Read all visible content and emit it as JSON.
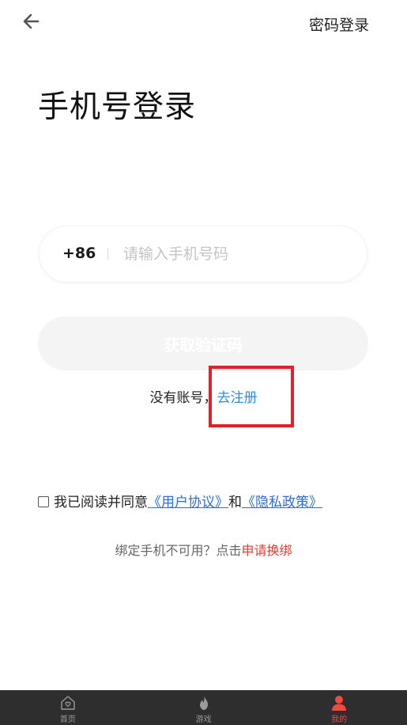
{
  "header": {
    "password_login": "密码登录"
  },
  "page_title": "手机号登录",
  "phone": {
    "country_code": "+86",
    "placeholder": "请输入手机号码",
    "value": ""
  },
  "get_code_button": "获取验证码",
  "register": {
    "prefix": "没有账号，",
    "link": "去注册"
  },
  "agreement": {
    "text": "我已阅读并同意",
    "user_agreement": "《用户协议》",
    "and": "和",
    "privacy_policy": "《隐私政策》",
    "checked": false
  },
  "rebind": {
    "text": "绑定手机不可用？点击",
    "link": "申请换绑"
  },
  "bottom_nav": {
    "items": [
      {
        "label": "首页",
        "icon": "home-icon"
      },
      {
        "label": "游戏",
        "icon": "flame-icon"
      },
      {
        "label": "我的",
        "icon": "user-icon",
        "active": true
      }
    ]
  },
  "colors": {
    "link_blue": "#2b8ee8",
    "agreement_blue": "#2b6fd6",
    "accent_red": "#e83a2f",
    "highlight_red": "#e0232b",
    "nav_bg": "#2e2e2e"
  }
}
